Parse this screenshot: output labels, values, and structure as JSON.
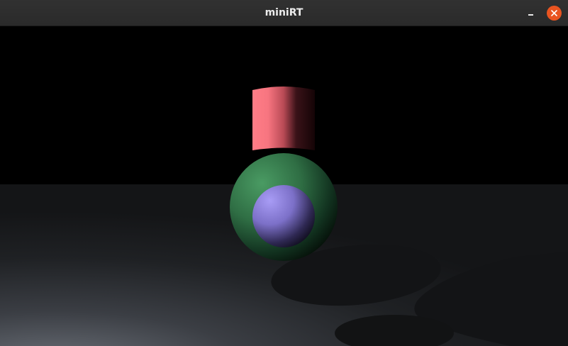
{
  "window": {
    "title": "miniRT",
    "controls": {
      "minimize_icon": "minimize-icon",
      "close_icon": "close-icon",
      "close_color": "#e95420"
    }
  },
  "scene": {
    "background_color": "#000000",
    "objects": [
      {
        "kind": "floor-plane",
        "color": "#4a4e55"
      },
      {
        "kind": "cylinder",
        "color": "#ff7b85"
      },
      {
        "kind": "sphere",
        "color": "#3c8a55"
      },
      {
        "kind": "sphere",
        "color": "#9c8fe8"
      }
    ]
  }
}
